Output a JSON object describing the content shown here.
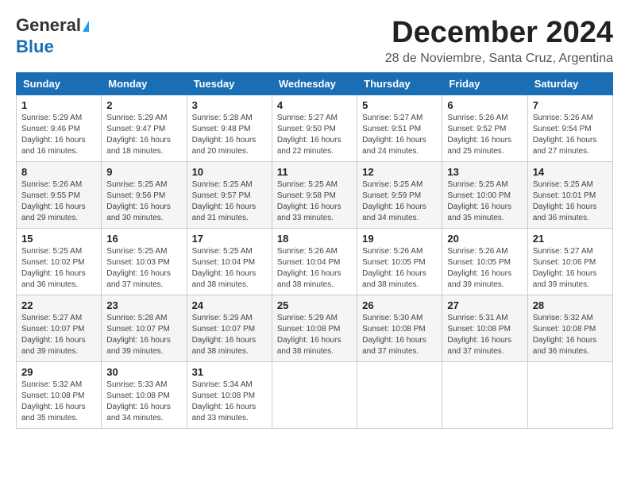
{
  "header": {
    "logo_line1": "General",
    "logo_line2": "Blue",
    "month_title": "December 2024",
    "subtitle": "28 de Noviembre, Santa Cruz, Argentina"
  },
  "weekdays": [
    "Sunday",
    "Monday",
    "Tuesday",
    "Wednesday",
    "Thursday",
    "Friday",
    "Saturday"
  ],
  "weeks": [
    [
      {
        "day": "1",
        "sunrise": "Sunrise: 5:29 AM",
        "sunset": "Sunset: 9:46 PM",
        "daylight": "Daylight: 16 hours and 16 minutes."
      },
      {
        "day": "2",
        "sunrise": "Sunrise: 5:29 AM",
        "sunset": "Sunset: 9:47 PM",
        "daylight": "Daylight: 16 hours and 18 minutes."
      },
      {
        "day": "3",
        "sunrise": "Sunrise: 5:28 AM",
        "sunset": "Sunset: 9:48 PM",
        "daylight": "Daylight: 16 hours and 20 minutes."
      },
      {
        "day": "4",
        "sunrise": "Sunrise: 5:27 AM",
        "sunset": "Sunset: 9:50 PM",
        "daylight": "Daylight: 16 hours and 22 minutes."
      },
      {
        "day": "5",
        "sunrise": "Sunrise: 5:27 AM",
        "sunset": "Sunset: 9:51 PM",
        "daylight": "Daylight: 16 hours and 24 minutes."
      },
      {
        "day": "6",
        "sunrise": "Sunrise: 5:26 AM",
        "sunset": "Sunset: 9:52 PM",
        "daylight": "Daylight: 16 hours and 25 minutes."
      },
      {
        "day": "7",
        "sunrise": "Sunrise: 5:26 AM",
        "sunset": "Sunset: 9:54 PM",
        "daylight": "Daylight: 16 hours and 27 minutes."
      }
    ],
    [
      {
        "day": "8",
        "sunrise": "Sunrise: 5:26 AM",
        "sunset": "Sunset: 9:55 PM",
        "daylight": "Daylight: 16 hours and 29 minutes."
      },
      {
        "day": "9",
        "sunrise": "Sunrise: 5:25 AM",
        "sunset": "Sunset: 9:56 PM",
        "daylight": "Daylight: 16 hours and 30 minutes."
      },
      {
        "day": "10",
        "sunrise": "Sunrise: 5:25 AM",
        "sunset": "Sunset: 9:57 PM",
        "daylight": "Daylight: 16 hours and 31 minutes."
      },
      {
        "day": "11",
        "sunrise": "Sunrise: 5:25 AM",
        "sunset": "Sunset: 9:58 PM",
        "daylight": "Daylight: 16 hours and 33 minutes."
      },
      {
        "day": "12",
        "sunrise": "Sunrise: 5:25 AM",
        "sunset": "Sunset: 9:59 PM",
        "daylight": "Daylight: 16 hours and 34 minutes."
      },
      {
        "day": "13",
        "sunrise": "Sunrise: 5:25 AM",
        "sunset": "Sunset: 10:00 PM",
        "daylight": "Daylight: 16 hours and 35 minutes."
      },
      {
        "day": "14",
        "sunrise": "Sunrise: 5:25 AM",
        "sunset": "Sunset: 10:01 PM",
        "daylight": "Daylight: 16 hours and 36 minutes."
      }
    ],
    [
      {
        "day": "15",
        "sunrise": "Sunrise: 5:25 AM",
        "sunset": "Sunset: 10:02 PM",
        "daylight": "Daylight: 16 hours and 36 minutes."
      },
      {
        "day": "16",
        "sunrise": "Sunrise: 5:25 AM",
        "sunset": "Sunset: 10:03 PM",
        "daylight": "Daylight: 16 hours and 37 minutes."
      },
      {
        "day": "17",
        "sunrise": "Sunrise: 5:25 AM",
        "sunset": "Sunset: 10:04 PM",
        "daylight": "Daylight: 16 hours and 38 minutes."
      },
      {
        "day": "18",
        "sunrise": "Sunrise: 5:26 AM",
        "sunset": "Sunset: 10:04 PM",
        "daylight": "Daylight: 16 hours and 38 minutes."
      },
      {
        "day": "19",
        "sunrise": "Sunrise: 5:26 AM",
        "sunset": "Sunset: 10:05 PM",
        "daylight": "Daylight: 16 hours and 38 minutes."
      },
      {
        "day": "20",
        "sunrise": "Sunrise: 5:26 AM",
        "sunset": "Sunset: 10:05 PM",
        "daylight": "Daylight: 16 hours and 39 minutes."
      },
      {
        "day": "21",
        "sunrise": "Sunrise: 5:27 AM",
        "sunset": "Sunset: 10:06 PM",
        "daylight": "Daylight: 16 hours and 39 minutes."
      }
    ],
    [
      {
        "day": "22",
        "sunrise": "Sunrise: 5:27 AM",
        "sunset": "Sunset: 10:07 PM",
        "daylight": "Daylight: 16 hours and 39 minutes."
      },
      {
        "day": "23",
        "sunrise": "Sunrise: 5:28 AM",
        "sunset": "Sunset: 10:07 PM",
        "daylight": "Daylight: 16 hours and 39 minutes."
      },
      {
        "day": "24",
        "sunrise": "Sunrise: 5:29 AM",
        "sunset": "Sunset: 10:07 PM",
        "daylight": "Daylight: 16 hours and 38 minutes."
      },
      {
        "day": "25",
        "sunrise": "Sunrise: 5:29 AM",
        "sunset": "Sunset: 10:08 PM",
        "daylight": "Daylight: 16 hours and 38 minutes."
      },
      {
        "day": "26",
        "sunrise": "Sunrise: 5:30 AM",
        "sunset": "Sunset: 10:08 PM",
        "daylight": "Daylight: 16 hours and 37 minutes."
      },
      {
        "day": "27",
        "sunrise": "Sunrise: 5:31 AM",
        "sunset": "Sunset: 10:08 PM",
        "daylight": "Daylight: 16 hours and 37 minutes."
      },
      {
        "day": "28",
        "sunrise": "Sunrise: 5:32 AM",
        "sunset": "Sunset: 10:08 PM",
        "daylight": "Daylight: 16 hours and 36 minutes."
      }
    ],
    [
      {
        "day": "29",
        "sunrise": "Sunrise: 5:32 AM",
        "sunset": "Sunset: 10:08 PM",
        "daylight": "Daylight: 16 hours and 35 minutes."
      },
      {
        "day": "30",
        "sunrise": "Sunrise: 5:33 AM",
        "sunset": "Sunset: 10:08 PM",
        "daylight": "Daylight: 16 hours and 34 minutes."
      },
      {
        "day": "31",
        "sunrise": "Sunrise: 5:34 AM",
        "sunset": "Sunset: 10:08 PM",
        "daylight": "Daylight: 16 hours and 33 minutes."
      },
      null,
      null,
      null,
      null
    ]
  ]
}
